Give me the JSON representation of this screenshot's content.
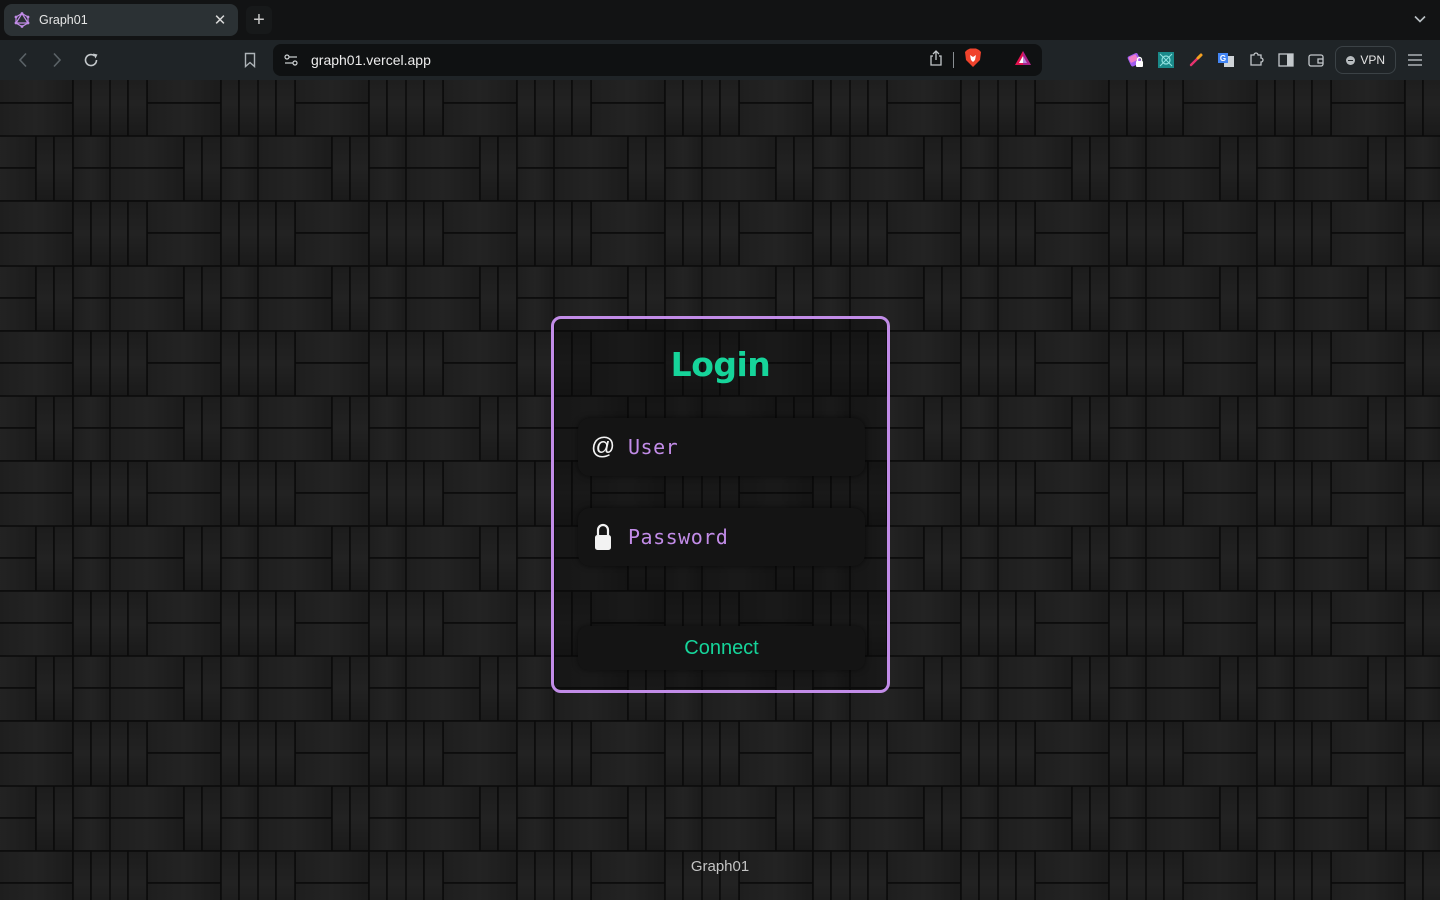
{
  "browser": {
    "tab": {
      "title": "Graph01",
      "favicon": "graphql-logo-icon"
    },
    "new_tab_label": "+",
    "url": "graph01.vercel.app",
    "vpn_label": "VPN",
    "extensions": [
      "wallet-lock-icon",
      "robot-extension-icon",
      "color-picker-icon",
      "google-translate-icon",
      "extensions-puzzle-icon",
      "sidebar-icon",
      "wallet-icon"
    ]
  },
  "login": {
    "title": "Login",
    "user_placeholder": "User",
    "user_icon": "@",
    "password_placeholder": "Password",
    "connect_label": "Connect"
  },
  "footer": {
    "text": "Graph01"
  },
  "colors": {
    "accent_green": "#16d49a",
    "accent_purple": "#c28ce8",
    "card_border": "#c28ce8"
  }
}
